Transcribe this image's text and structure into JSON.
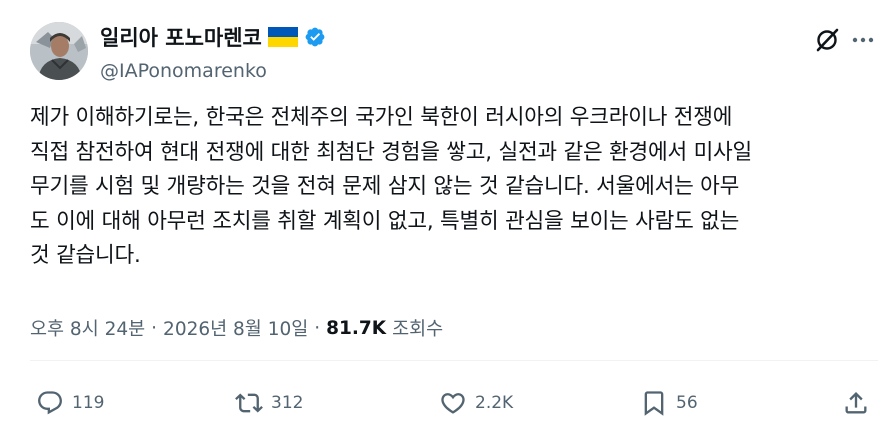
{
  "author": {
    "name": "일리아 포노마렌코",
    "handle": "@IAPonomarenko"
  },
  "tweet": {
    "lines": [
      "제가 이해하기로는, 한국은 전체주의 국가인 북한이 러시아의 우크라이나 전쟁에",
      "직접 참전하여 현대 전쟁에 대한 최첨단 경험을 쌓고, 실전과 같은 환경에서 미사일",
      "무기를 시험 및 개량하는 것을 전혀 문제 삼지 않는 것 같습니다. 서울에서는 아무",
      "도 이에 대해 아무런 조치를 취할 계획이 없고, 특별히 관심을 보이는 사람도 없는",
      "것 같습니다."
    ]
  },
  "meta": {
    "time": "오후 8시 24분",
    "date": "2026년 8월 10일",
    "separator": "·",
    "views": "81.7K",
    "views_label": "조회수"
  },
  "actions": {
    "replies": "119",
    "reposts": "312",
    "likes": "2.2K",
    "bookmarks": "56"
  },
  "colors": {
    "text": "#0f1419",
    "secondary": "#536471",
    "verified": "#1d9bf0",
    "flag_blue": "#0057b7",
    "flag_yellow": "#ffd700"
  },
  "icons": [
    "verified-badge-icon",
    "ukraine-flag-icon",
    "grok-icon",
    "more-icon",
    "reply-icon",
    "repost-icon",
    "like-icon",
    "bookmark-icon",
    "share-icon"
  ]
}
